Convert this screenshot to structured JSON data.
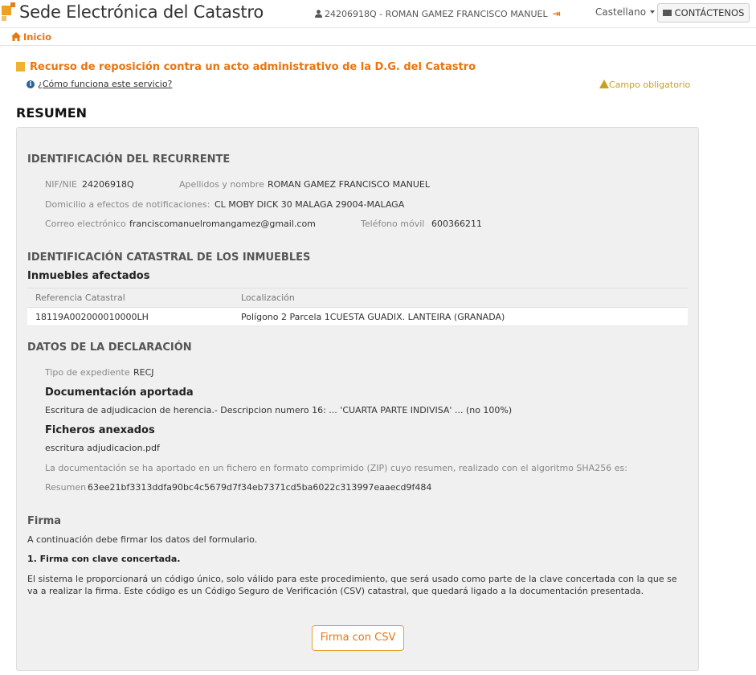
{
  "header": {
    "site_title": "Sede Electrónica del Catastro",
    "user": "24206918Q - ROMAN GAMEZ FRANCISCO MANUEL",
    "language": "Castellano",
    "contact_label": "CONTÁCTENOS"
  },
  "breadcrumb": {
    "home_label": "Inicio"
  },
  "page": {
    "heading": "Recurso de reposición contra un acto administrativo de la D.G. del Catastro",
    "help_link": "¿Cómo funciona este servicio?",
    "required_note": "Campo obligatorio",
    "summary_title": "RESUMEN"
  },
  "recurrente": {
    "title": "IDENTIFICACIÓN DEL RECURRENTE",
    "nif_label": "NIF/NIE",
    "nif_value": "24206918Q",
    "name_label": "Apellidos y nombre",
    "name_value": "ROMAN GAMEZ FRANCISCO MANUEL",
    "address_label": "Domicilio a efectos de notificaciones:",
    "address_value": "CL MOBY DICK 30 MALAGA 29004-MALAGA",
    "email_label": "Correo electrónico",
    "email_value": "franciscomanuelromangamez@gmail.com",
    "phone_label": "Teléfono móvil",
    "phone_value": "600366211"
  },
  "inmuebles": {
    "title": "IDENTIFICACIÓN CATASTRAL DE LOS INMUEBLES",
    "subtitle": "Inmuebles afectados",
    "columns": [
      "Referencia Catastral",
      "Localización"
    ],
    "rows": [
      [
        "18119A002000010000LH",
        "Polígono 2 Parcela 1CUESTA GUADIX. LANTEIRA (GRANADA)"
      ]
    ]
  },
  "declaracion": {
    "title": "DATOS DE LA DECLARACIÓN",
    "tipo_label": "Tipo de expediente",
    "tipo_value": "RECJ",
    "doc_title": "Documentación aportada",
    "doc_text": "Escritura de adjudicacion de herencia.- Descripcion numero 16: ... 'CUARTA PARTE INDIVISA' ... (no 100%)",
    "files_title": "Ficheros anexados",
    "file_name": "escritura adjudicacion.pdf",
    "zip_note": "La documentación se ha aportado en un fichero en formato comprimido (ZIP) cuyo resumen, realizado con el algoritmo SHA256 es:",
    "hash_label": "Resumen",
    "hash_value": "63ee21bf3313ddfa90bc4c5679d7f34eb7371cd5ba6022c313997eaaecd9f484"
  },
  "firma": {
    "title": "Firma",
    "intro": "A continuación debe firmar los datos del formulario.",
    "option_title": "1. Firma con clave concertada.",
    "description": "El sistema le proporcionará un código único, solo válido para este procedimiento, que será usado como parte de la clave concertada con la que se va a realizar la firma. Este código es un Código Seguro de Verificación (CSV) catastral, que quedará ligado a la documentación presentada.",
    "button_label": "Firma con CSV"
  }
}
